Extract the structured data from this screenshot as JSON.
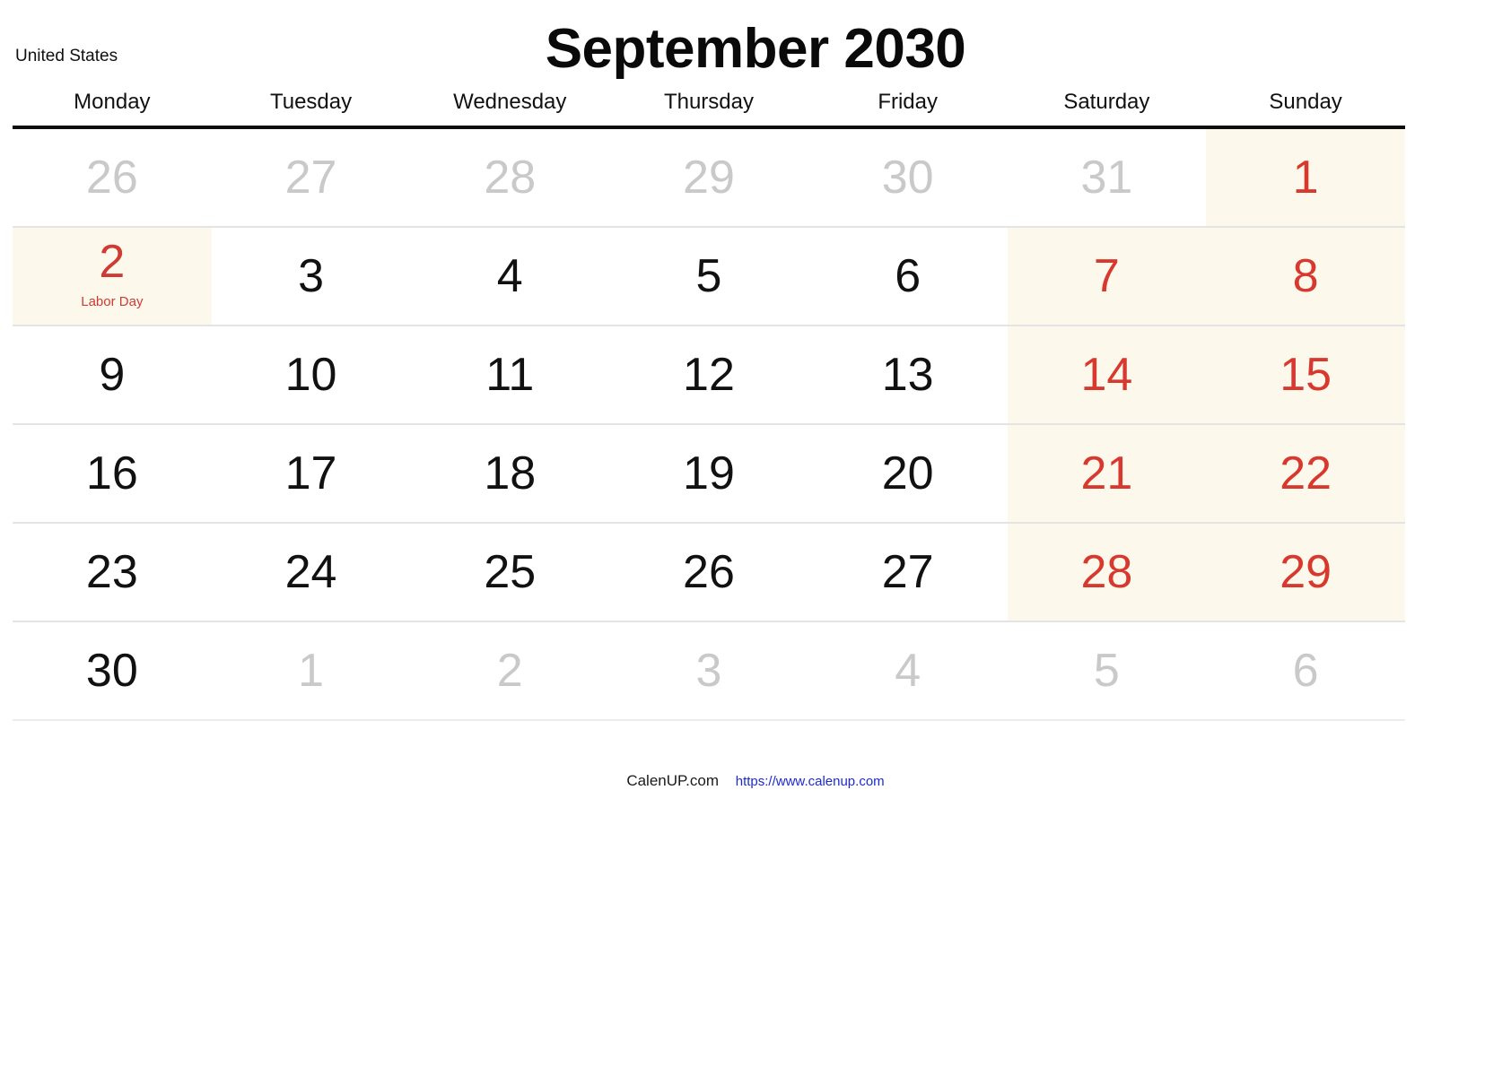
{
  "header": {
    "country": "United States",
    "title": "September 2030"
  },
  "weekdays": [
    "Monday",
    "Tuesday",
    "Wednesday",
    "Thursday",
    "Friday",
    "Saturday",
    "Sunday"
  ],
  "colors": {
    "weekend_background": "#fdf8ec",
    "weekend_text": "#d8392f",
    "holiday_text": "#cf3a33",
    "other_month_text": "#c9c9c9",
    "current_month_text": "#111111",
    "header_rule": "#0d0d0d",
    "row_rule": "#e4e4e4",
    "url_link": "#1e2ad0"
  },
  "weeks": [
    {
      "days": [
        {
          "num": "26",
          "month": "prev"
        },
        {
          "num": "27",
          "month": "prev"
        },
        {
          "num": "28",
          "month": "prev"
        },
        {
          "num": "29",
          "month": "prev"
        },
        {
          "num": "30",
          "month": "prev"
        },
        {
          "num": "31",
          "month": "prev"
        },
        {
          "num": "1",
          "month": "current",
          "weekend": "sun",
          "shaded": true
        }
      ]
    },
    {
      "days": [
        {
          "num": "2",
          "month": "current",
          "holiday": "Labor Day",
          "shaded": true
        },
        {
          "num": "3",
          "month": "current"
        },
        {
          "num": "4",
          "month": "current"
        },
        {
          "num": "5",
          "month": "current"
        },
        {
          "num": "6",
          "month": "current"
        },
        {
          "num": "7",
          "month": "current",
          "weekend": "sat",
          "shaded": true
        },
        {
          "num": "8",
          "month": "current",
          "weekend": "sun",
          "shaded": true
        }
      ]
    },
    {
      "days": [
        {
          "num": "9",
          "month": "current"
        },
        {
          "num": "10",
          "month": "current"
        },
        {
          "num": "11",
          "month": "current"
        },
        {
          "num": "12",
          "month": "current"
        },
        {
          "num": "13",
          "month": "current"
        },
        {
          "num": "14",
          "month": "current",
          "weekend": "sat",
          "shaded": true
        },
        {
          "num": "15",
          "month": "current",
          "weekend": "sun",
          "shaded": true
        }
      ]
    },
    {
      "days": [
        {
          "num": "16",
          "month": "current"
        },
        {
          "num": "17",
          "month": "current"
        },
        {
          "num": "18",
          "month": "current"
        },
        {
          "num": "19",
          "month": "current"
        },
        {
          "num": "20",
          "month": "current"
        },
        {
          "num": "21",
          "month": "current",
          "weekend": "sat",
          "shaded": true
        },
        {
          "num": "22",
          "month": "current",
          "weekend": "sun",
          "shaded": true
        }
      ]
    },
    {
      "days": [
        {
          "num": "23",
          "month": "current"
        },
        {
          "num": "24",
          "month": "current"
        },
        {
          "num": "25",
          "month": "current"
        },
        {
          "num": "26",
          "month": "current"
        },
        {
          "num": "27",
          "month": "current"
        },
        {
          "num": "28",
          "month": "current",
          "weekend": "sat",
          "shaded": true
        },
        {
          "num": "29",
          "month": "current",
          "weekend": "sun",
          "shaded": true
        }
      ]
    },
    {
      "days": [
        {
          "num": "30",
          "month": "current"
        },
        {
          "num": "1",
          "month": "next"
        },
        {
          "num": "2",
          "month": "next"
        },
        {
          "num": "3",
          "month": "next"
        },
        {
          "num": "4",
          "month": "next"
        },
        {
          "num": "5",
          "month": "next",
          "weekend": "sat"
        },
        {
          "num": "6",
          "month": "next",
          "weekend": "sun"
        }
      ]
    }
  ],
  "footer": {
    "brand": "CalenUP.com",
    "url": "https://www.calenup.com"
  }
}
